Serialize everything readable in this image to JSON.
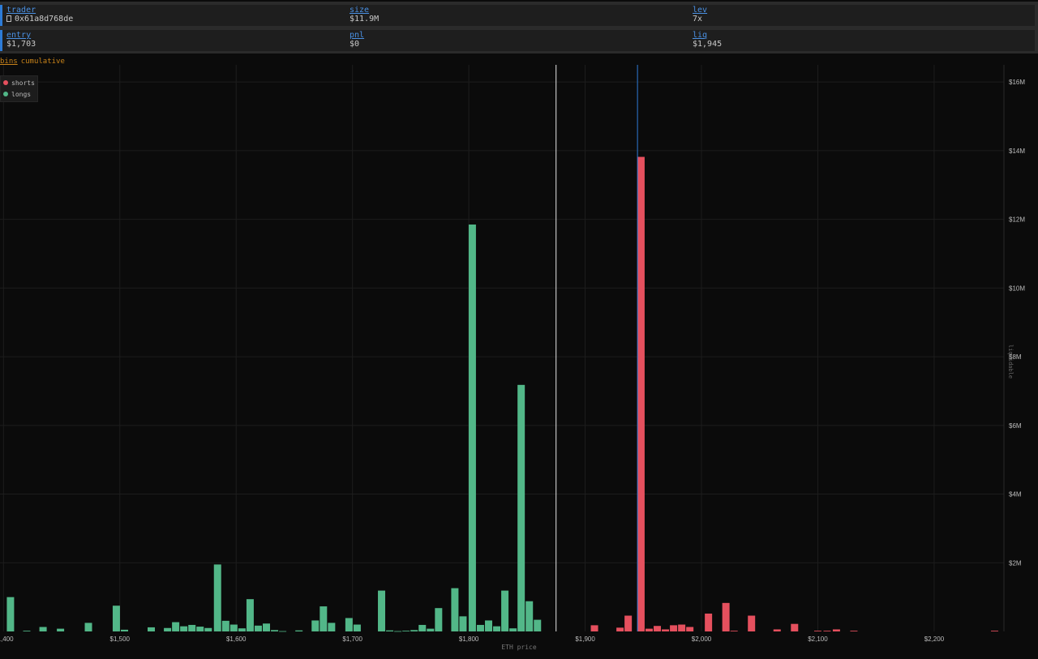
{
  "info": {
    "trader_label": "trader",
    "trader_value": "0x61a8d768de",
    "size_label": "size",
    "size_value": "$11.9M",
    "lev_label": "lev",
    "lev_value": "7x",
    "entry_label": "entry",
    "entry_value": "$1,703",
    "pnl_label": "pnl",
    "pnl_value": "$0",
    "liq_label": "liq",
    "liq_value": "$1,945"
  },
  "modes": {
    "bins": "bins",
    "cumulative": "cumulative"
  },
  "legend": {
    "shorts": "shorts",
    "longs": "longs"
  },
  "colors": {
    "shorts": "#e5505e",
    "longs": "#52b788",
    "liq_line": "#2d7bd6",
    "price_line": "#e6e6e6"
  },
  "chart_data": {
    "type": "bar",
    "xlabel": "ETH price",
    "ylabel": "liquidable",
    "xlim": [
      1397,
      2260
    ],
    "ylim": [
      0,
      16500000
    ],
    "bin_width": 7.1,
    "x_ticks": [
      1400,
      1500,
      1600,
      1700,
      1800,
      1900,
      2000,
      2100,
      2200
    ],
    "x_tick_labels": [
      "$1,400",
      "$1,500",
      "$1,600",
      "$1,700",
      "$1,800",
      "$1,900",
      "$2,000",
      "$2,100",
      "$2,200"
    ],
    "y_ticks": [
      2000000,
      4000000,
      6000000,
      8000000,
      10000000,
      12000000,
      14000000,
      16000000
    ],
    "y_tick_labels": [
      "$2M",
      "$4M",
      "$6M",
      "$8M",
      "$10M",
      "$12M",
      "$14M",
      "$16M"
    ],
    "current_price": 1875,
    "liq_price": 1945,
    "series": [
      {
        "name": "longs",
        "points": [
          [
            1406,
            1000000
          ],
          [
            1420,
            20000
          ],
          [
            1434,
            130000
          ],
          [
            1449,
            80000
          ],
          [
            1473,
            250000
          ],
          [
            1497,
            750000
          ],
          [
            1504,
            50000
          ],
          [
            1527,
            120000
          ],
          [
            1541,
            100000
          ],
          [
            1548,
            270000
          ],
          [
            1555,
            150000
          ],
          [
            1562,
            190000
          ],
          [
            1569,
            140000
          ],
          [
            1576,
            100000
          ],
          [
            1584,
            1950000
          ],
          [
            1591,
            310000
          ],
          [
            1598,
            200000
          ],
          [
            1605,
            90000
          ],
          [
            1612,
            940000
          ],
          [
            1619,
            170000
          ],
          [
            1626,
            230000
          ],
          [
            1633,
            40000
          ],
          [
            1640,
            10000
          ],
          [
            1654,
            30000
          ],
          [
            1668,
            320000
          ],
          [
            1675,
            730000
          ],
          [
            1682,
            250000
          ],
          [
            1697,
            390000
          ],
          [
            1704,
            200000
          ],
          [
            1725,
            1190000
          ],
          [
            1732,
            30000
          ],
          [
            1739,
            10000
          ],
          [
            1746,
            20000
          ],
          [
            1753,
            40000
          ],
          [
            1760,
            190000
          ],
          [
            1767,
            80000
          ],
          [
            1774,
            680000
          ],
          [
            1788,
            1260000
          ],
          [
            1795,
            440000
          ],
          [
            1803,
            11850000
          ],
          [
            1810,
            190000
          ],
          [
            1817,
            320000
          ],
          [
            1824,
            150000
          ],
          [
            1831,
            1190000
          ],
          [
            1838,
            90000
          ],
          [
            1845,
            7180000
          ],
          [
            1852,
            880000
          ],
          [
            1859,
            340000
          ]
        ]
      },
      {
        "name": "shorts",
        "points": [
          [
            1908,
            180000
          ],
          [
            1930,
            110000
          ],
          [
            1937,
            460000
          ],
          [
            1948,
            13820000
          ],
          [
            1955,
            80000
          ],
          [
            1962,
            160000
          ],
          [
            1969,
            60000
          ],
          [
            1976,
            180000
          ],
          [
            1983,
            200000
          ],
          [
            1990,
            130000
          ],
          [
            2006,
            520000
          ],
          [
            2021,
            830000
          ],
          [
            2028,
            20000
          ],
          [
            2043,
            460000
          ],
          [
            2065,
            60000
          ],
          [
            2080,
            220000
          ],
          [
            2100,
            20000
          ],
          [
            2108,
            20000
          ],
          [
            2116,
            60000
          ],
          [
            2131,
            20000
          ],
          [
            2252,
            20000
          ]
        ]
      }
    ]
  }
}
